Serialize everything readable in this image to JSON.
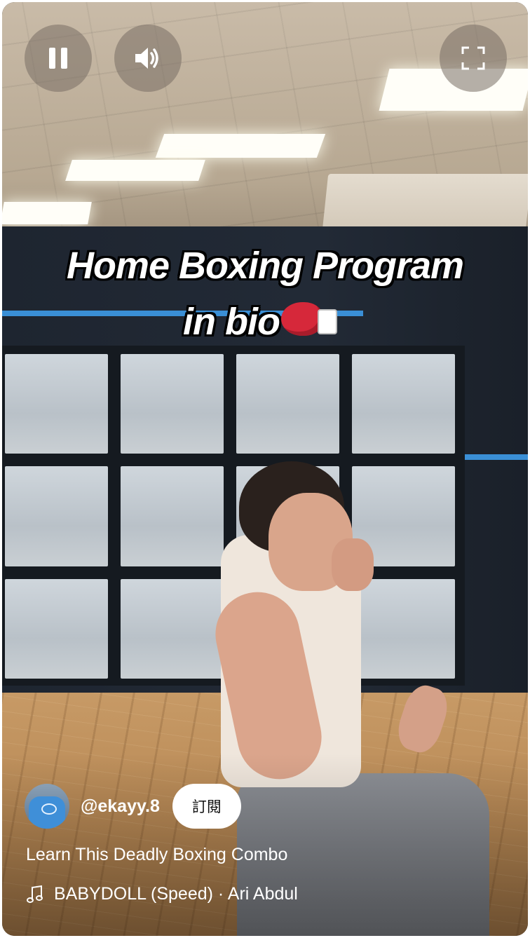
{
  "video": {
    "overlay_line1": "Home Boxing Program",
    "overlay_line2": "in bio"
  },
  "controls": {
    "pause_icon": "pause-icon",
    "volume_icon": "volume-icon",
    "fullscreen_icon": "fullscreen-icon"
  },
  "channel": {
    "handle": "@ekayy.8",
    "subscribe_label": "訂閱"
  },
  "short": {
    "title": "Learn This Deadly Boxing Combo",
    "music": "BABYDOLL (Speed) · Ari Abdul",
    "music_icon": "music-note-icon"
  },
  "colors": {
    "subscribe_bg": "#ffffff",
    "wall_stripe": "#3a8fd6"
  }
}
